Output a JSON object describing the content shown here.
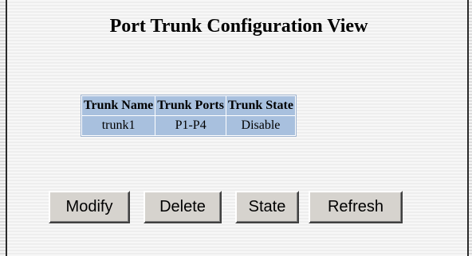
{
  "page": {
    "title": "Port Trunk Configuration View"
  },
  "table": {
    "headers": [
      "Trunk Name",
      "Trunk Ports",
      "Trunk State"
    ],
    "rows": [
      [
        "trunk1",
        "P1-P4",
        "Disable"
      ]
    ]
  },
  "buttons": {
    "modify": "Modify",
    "delete": "Delete",
    "state": "State",
    "refresh": "Refresh"
  },
  "colors": {
    "table_cell_bg": "#a8c0de",
    "button_face": "#d6d3ce"
  }
}
